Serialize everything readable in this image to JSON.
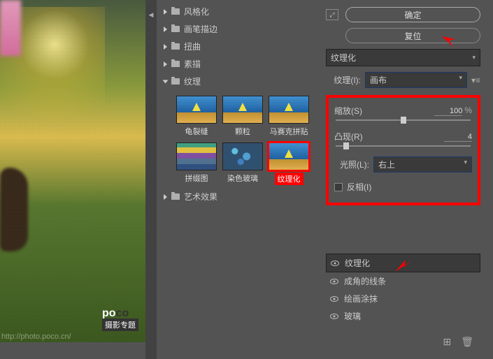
{
  "folders": {
    "stylize": "风格化",
    "brushStrokes": "画笔描边",
    "distort": "扭曲",
    "sketch": "素描",
    "texture": "纹理",
    "artistic": "艺术效果"
  },
  "thumbs": {
    "t1": "龟裂缝",
    "t2": "颗粒",
    "t3": "马赛克拼贴",
    "t4": "拼缀图",
    "t5": "染色玻璃",
    "t6": "纹理化"
  },
  "buttons": {
    "ok": "确定",
    "reset": "复位"
  },
  "filterDropdown": "纹理化",
  "textureRow": {
    "label": "纹理(I):",
    "value": "画布"
  },
  "controls": {
    "scale": {
      "label": "缩放(S)",
      "value": "100",
      "unit": "%",
      "pos": 50
    },
    "relief": {
      "label": "凸现(R)",
      "value": "4",
      "pos": 8
    },
    "light": {
      "label": "光照(L):",
      "value": "右上"
    },
    "invert": "反相(I)"
  },
  "effects": {
    "e1": "纹理化",
    "e2": "成角的线条",
    "e3": "绘画涂抹",
    "e4": "玻璃"
  },
  "watermark": {
    "brand1": "po",
    "brand2": "co",
    "title": "摄影专题",
    "url": "http://photo.poco.cn/"
  }
}
